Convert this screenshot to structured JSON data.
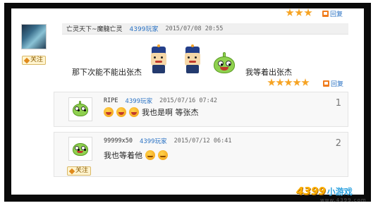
{
  "main_post": {
    "username": "亡灵天下~魔髓亡灵",
    "user_tag": "4399玩家",
    "date": "2015/07/08 20:55",
    "text_before": "那下次能不能出张杰",
    "text_after": "我等着出张杰",
    "follow_label": "关注",
    "reply_label": "回复",
    "top_rating": 3,
    "rating": 5
  },
  "replies": [
    {
      "username": "RIPE",
      "user_tag": "4399玩家",
      "date": "2015/07/16 07:42",
      "text": "我也是啊  等张杰",
      "floor": "1"
    },
    {
      "username": "99999x50",
      "user_tag": "4399玩家",
      "date": "2015/07/12 06:41",
      "text": "我也等着他",
      "floor": "2",
      "follow_label": "关注"
    }
  ],
  "logo": {
    "brand": "4399",
    "brand_sub": "小游戏",
    "url": "www.4399.com"
  },
  "colors": {
    "accent_blue": "#2a72c4",
    "star_orange": "#f6a323",
    "frame_black": "#0a0a0a"
  }
}
